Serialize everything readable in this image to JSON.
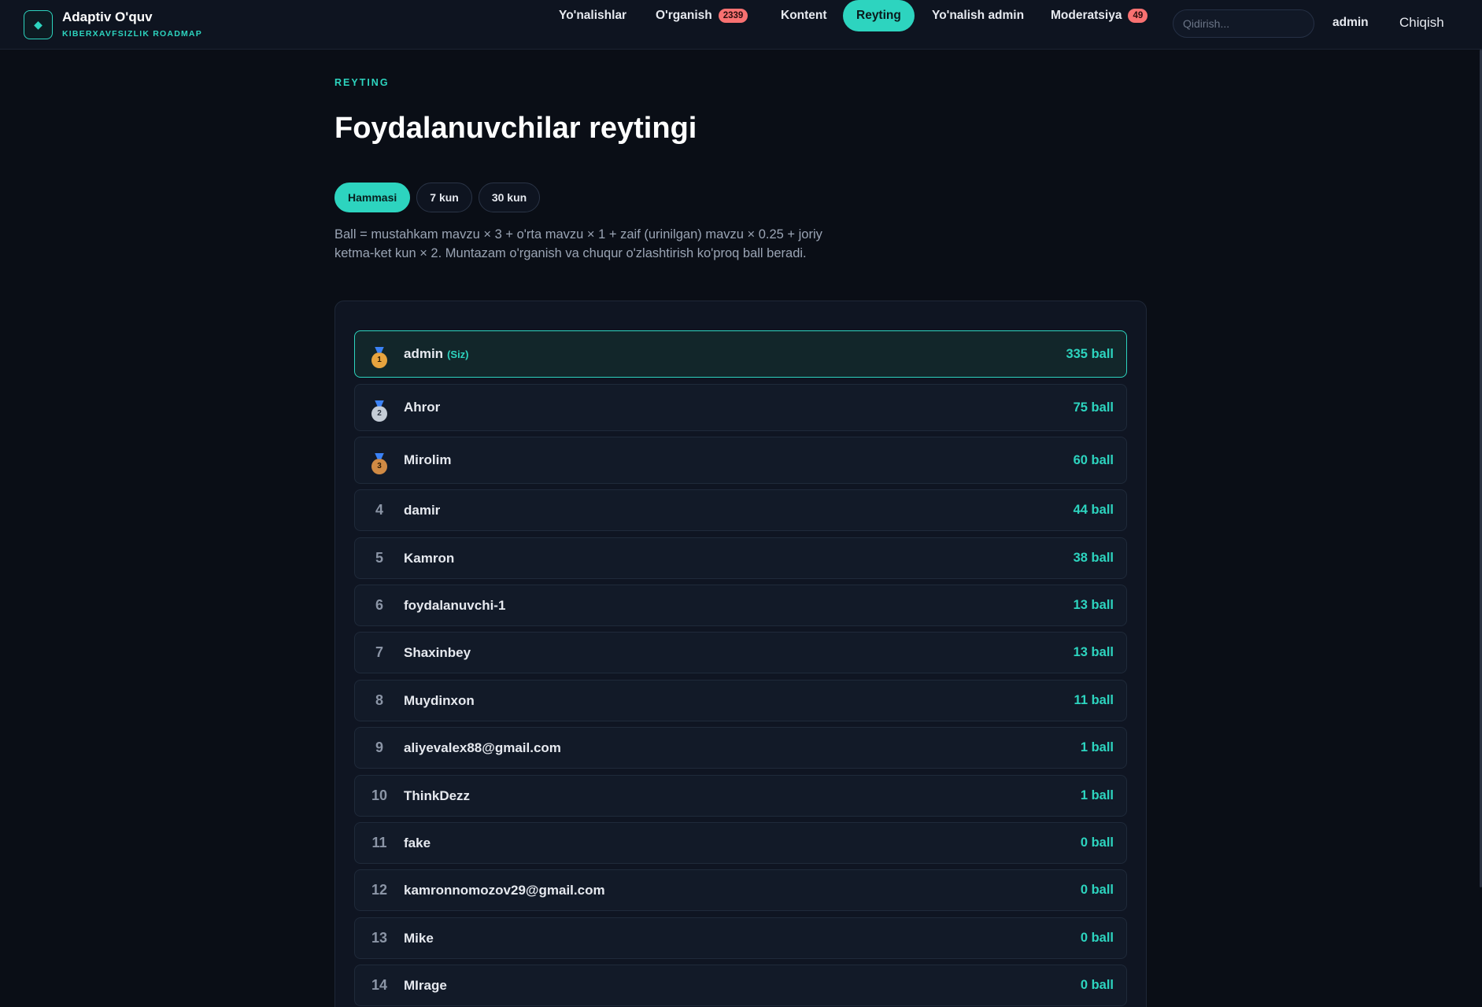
{
  "brand": {
    "title": "Adaptiv O'quv",
    "subtitle": "KIBERXAVFSIZLIK ROADMAP",
    "logo_icon": "◆"
  },
  "nav": {
    "items": [
      {
        "label": "Yo'nalishlar"
      },
      {
        "label": "O'rganish",
        "badge": "2339"
      },
      {
        "label": "Kontent"
      },
      {
        "label": "Reyting",
        "active": true
      },
      {
        "label": "Yo'nalish admin"
      },
      {
        "label": "Moderatsiya",
        "badge": "49"
      }
    ],
    "search_placeholder": "Qidirish...",
    "user": "admin",
    "logout": "Chiqish"
  },
  "page": {
    "eyebrow": "REYTING",
    "title": "Foydalanuvchilar reytingi",
    "filters": [
      "Hammasi",
      "7 kun",
      "30 kun"
    ],
    "active_filter": "Hammasi",
    "description": "Ball = mustahkam mavzu × 3 + o'rta mavzu × 1 + zaif (urinilgan) mavzu × 0.25 + joriy ketma-ket kun × 2. Muntazam o'rganish va chuqur o'zlashtirish ko'proq ball beradi."
  },
  "leaderboard": {
    "you_label": "(Siz)",
    "rows": [
      {
        "rank": "1",
        "name": "admin",
        "score": "335 ball",
        "is_me": true
      },
      {
        "rank": "2",
        "name": "Ahror",
        "score": "75 ball"
      },
      {
        "rank": "3",
        "name": "Mirolim",
        "score": "60 ball"
      },
      {
        "rank": "4",
        "name": "damir",
        "score": "44 ball"
      },
      {
        "rank": "5",
        "name": "Kamron",
        "score": "38 ball"
      },
      {
        "rank": "6",
        "name": "foydalanuvchi-1",
        "score": "13 ball"
      },
      {
        "rank": "7",
        "name": "Shaxinbey",
        "score": "13 ball"
      },
      {
        "rank": "8",
        "name": "Muydinxon",
        "score": "11 ball"
      },
      {
        "rank": "9",
        "name": "aliyevalex88@gmail.com",
        "score": "1 ball"
      },
      {
        "rank": "10",
        "name": "ThinkDezz",
        "score": "1 ball"
      },
      {
        "rank": "11",
        "name": "fake",
        "score": "0 ball"
      },
      {
        "rank": "12",
        "name": "kamronnomozov29@gmail.com",
        "score": "0 ball"
      },
      {
        "rank": "13",
        "name": "Mike",
        "score": "0 ball"
      },
      {
        "rank": "14",
        "name": "MIrage",
        "score": "0 ball"
      }
    ]
  },
  "colors": {
    "accent": "#2dd4bf",
    "badge": "#f87171",
    "background": "#0a0e16"
  }
}
